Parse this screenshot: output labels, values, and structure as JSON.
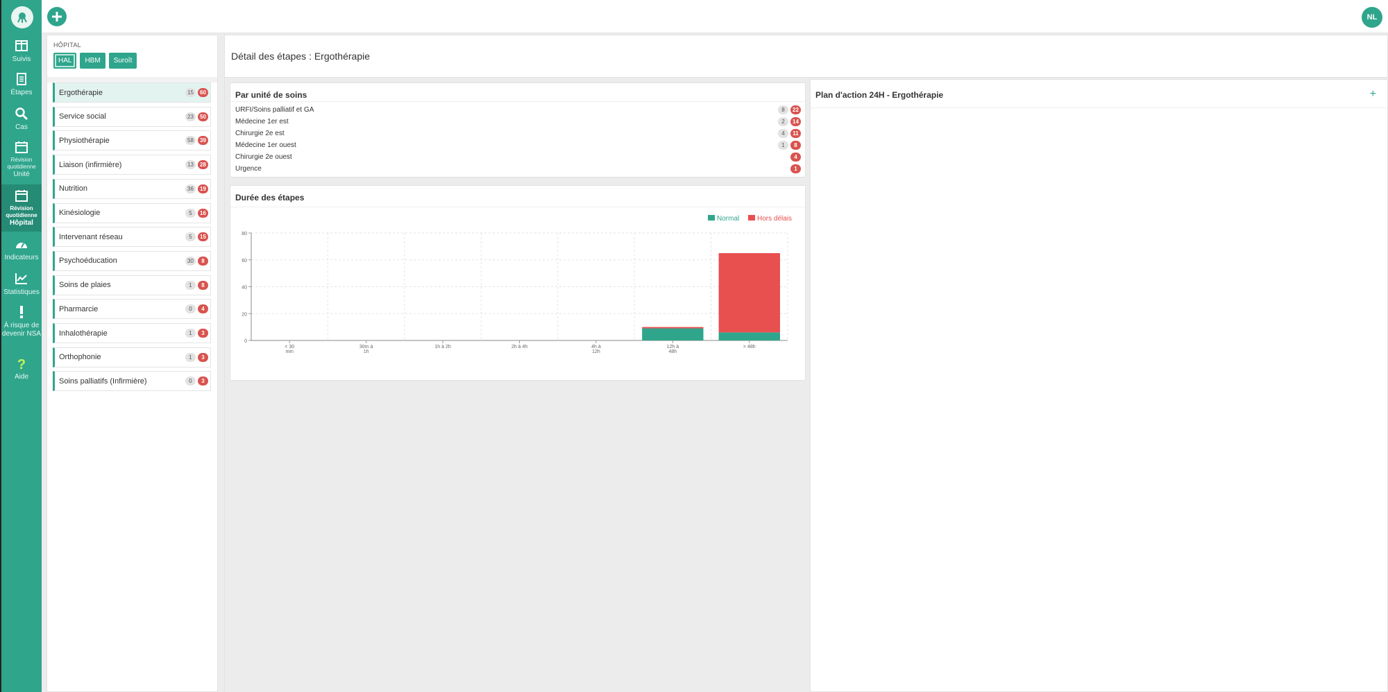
{
  "nav": {
    "items": [
      {
        "label": "Suivis"
      },
      {
        "label": "Étapes"
      },
      {
        "label": "Cas"
      },
      {
        "label_small": "Révision quotidienne",
        "label": "Unité"
      },
      {
        "label_small": "Révision quotidienne",
        "label": "Hôpital"
      },
      {
        "label": "Indicateurs"
      },
      {
        "label": "Statistiques"
      },
      {
        "label": "À risque de devenir NSA"
      },
      {
        "label": "Aide"
      }
    ]
  },
  "topbar": {
    "avatar": "NL"
  },
  "hospital": {
    "label": "HÔPITAL",
    "buttons": [
      "HAL",
      "HBM",
      "Suroît"
    ],
    "selected": "HAL"
  },
  "steps": [
    {
      "label": "Ergothérapie",
      "grey": "15",
      "red": "60"
    },
    {
      "label": "Service social",
      "grey": "23",
      "red": "50"
    },
    {
      "label": "Physiothérapie",
      "grey": "58",
      "red": "39"
    },
    {
      "label": "Liaison (infirmière)",
      "grey": "13",
      "red": "28"
    },
    {
      "label": "Nutrition",
      "grey": "36",
      "red": "19"
    },
    {
      "label": "Kinésiologie",
      "grey": "5",
      "red": "16"
    },
    {
      "label": "Intervenant réseau",
      "grey": "5",
      "red": "15"
    },
    {
      "label": "Psychoéducation",
      "grey": "30",
      "red": "8"
    },
    {
      "label": "Soins de plaies",
      "grey": "1",
      "red": "8"
    },
    {
      "label": "Pharmarcie",
      "grey": "0",
      "red": "4"
    },
    {
      "label": "Inhalothérapie",
      "grey": "1",
      "red": "3"
    },
    {
      "label": "Orthophonie",
      "grey": "1",
      "red": "3"
    },
    {
      "label": "Soins palliatifs (Infirmière)",
      "grey": "0",
      "red": "3"
    }
  ],
  "main": {
    "title": "Détail des étapes : Ergothérapie"
  },
  "units": {
    "title": "Par unité de soins",
    "rows": [
      {
        "label": "URFI/Soins palliatif et GA",
        "grey": "8",
        "red": "22"
      },
      {
        "label": "Médecine 1er est",
        "grey": "2",
        "red": "14"
      },
      {
        "label": "Chirurgie 2e est",
        "grey": "4",
        "red": "11"
      },
      {
        "label": "Médecine 1er ouest",
        "grey": "1",
        "red": "8"
      },
      {
        "label": "Chirurgie 2e ouest",
        "grey": "",
        "red": "4"
      },
      {
        "label": "Urgence",
        "grey": "",
        "red": "1"
      }
    ]
  },
  "plan": {
    "title": "Plan d'action 24H - Ergothérapie",
    "add": "+"
  },
  "chart_data": {
    "type": "bar",
    "title": "Durée des étapes",
    "stacked": true,
    "categories": [
      [
        "< 30",
        "min"
      ],
      [
        "30m à",
        "1h"
      ],
      [
        "1h à 2h"
      ],
      [
        "2h à 4h"
      ],
      [
        "4h à",
        "12h"
      ],
      [
        "12h à",
        "48h"
      ],
      [
        "> 48h"
      ]
    ],
    "series": [
      {
        "name": "Normal",
        "color": "#2fa58c",
        "values": [
          0,
          0,
          0,
          0,
          0,
          9,
          6
        ]
      },
      {
        "name": "Hors délais",
        "color": "#e84f4f",
        "values": [
          0,
          0,
          0,
          0,
          0,
          1,
          59
        ]
      }
    ],
    "ylim": [
      0,
      80
    ],
    "yticks": [
      "0",
      "20",
      "40",
      "60",
      "80"
    ],
    "grid": true,
    "legend": "top-right"
  }
}
